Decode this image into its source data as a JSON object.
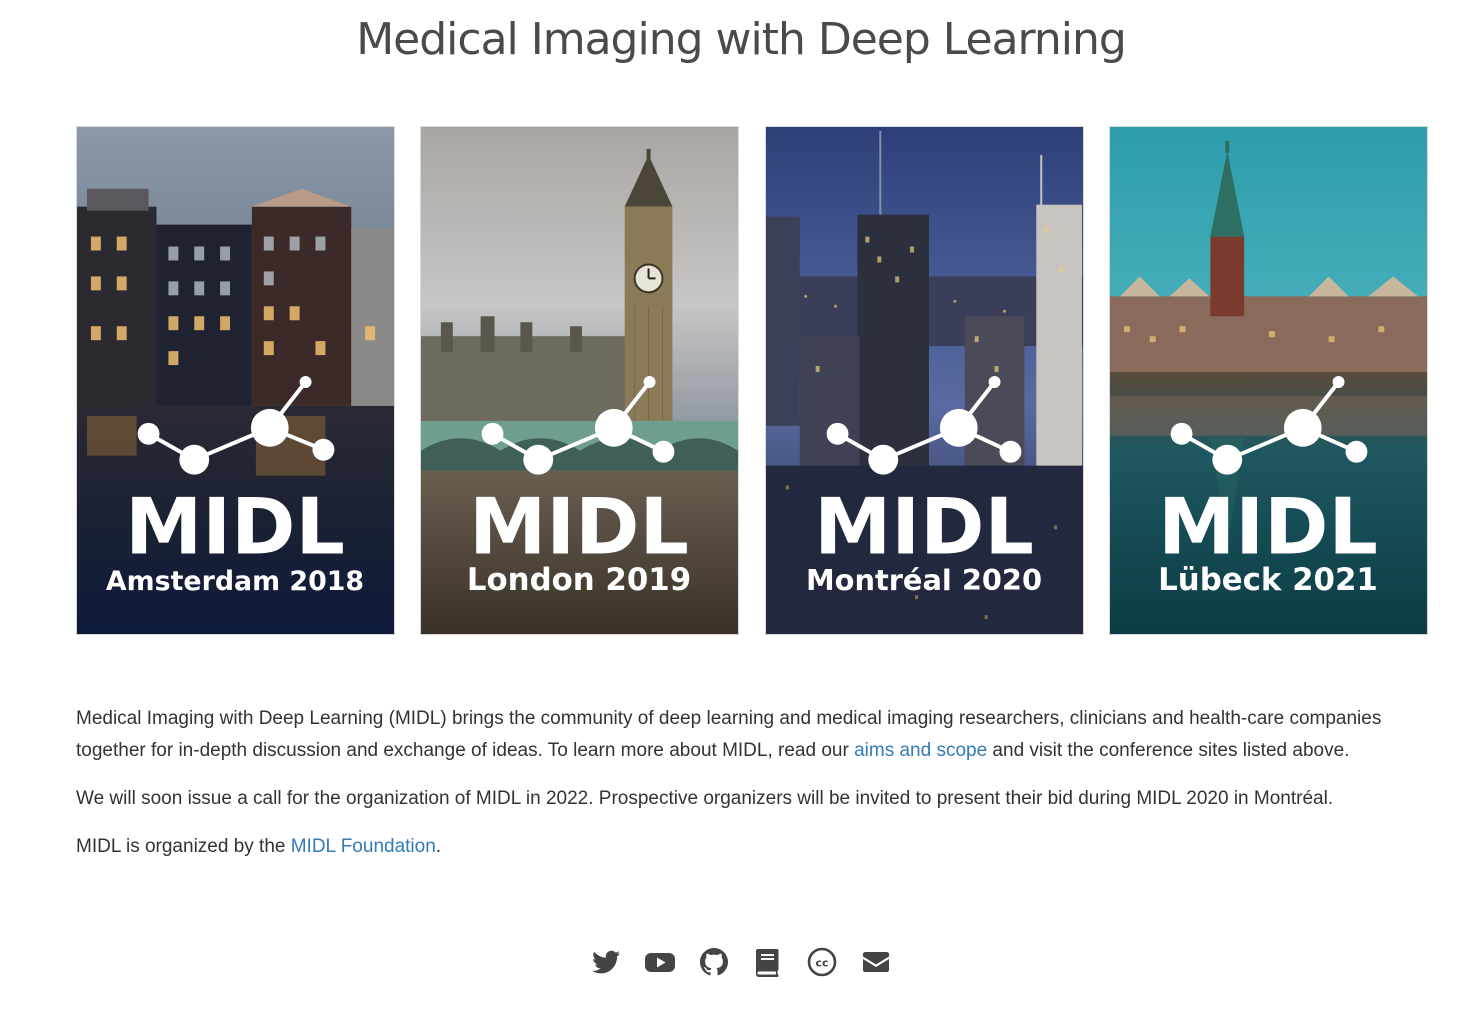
{
  "page": {
    "title": "Medical Imaging with Deep Learning"
  },
  "posters": [
    {
      "brand": "MIDL",
      "city_year": "Amsterdam 2018",
      "theme": "amsterdam"
    },
    {
      "brand": "MIDL",
      "city_year": "London 2019",
      "theme": "london"
    },
    {
      "brand": "MIDL",
      "city_year": "Montréal 2020",
      "theme": "montreal"
    },
    {
      "brand": "MIDL",
      "city_year": "Lübeck 2021",
      "theme": "lubeck"
    }
  ],
  "intro": {
    "p1_before": "Medical Imaging with Deep Learning (MIDL) brings the community of deep learning and medical imaging researchers, clinicians and health-care companies together for in-depth discussion and exchange of ideas. To learn more about MIDL, read our ",
    "p1_link": "aims and scope",
    "p1_after": " and visit the conference sites listed above.",
    "p2": "We will soon issue a call for the organization of MIDL in 2022. Prospective organizers will be invited to present their bid during MIDL 2020 in Montréal.",
    "p3_before": "MIDL is organized by the ",
    "p3_link": "MIDL Foundation",
    "p3_after": "."
  },
  "social": [
    {
      "icon": "twitter-icon"
    },
    {
      "icon": "youtube-icon"
    },
    {
      "icon": "github-icon"
    },
    {
      "icon": "book-icon"
    },
    {
      "icon": "creative-commons-icon"
    },
    {
      "icon": "envelope-icon"
    }
  ],
  "colors": {
    "link": "#337ab7",
    "text": "#333333",
    "title": "#4a4a4a",
    "icon": "#444444"
  }
}
